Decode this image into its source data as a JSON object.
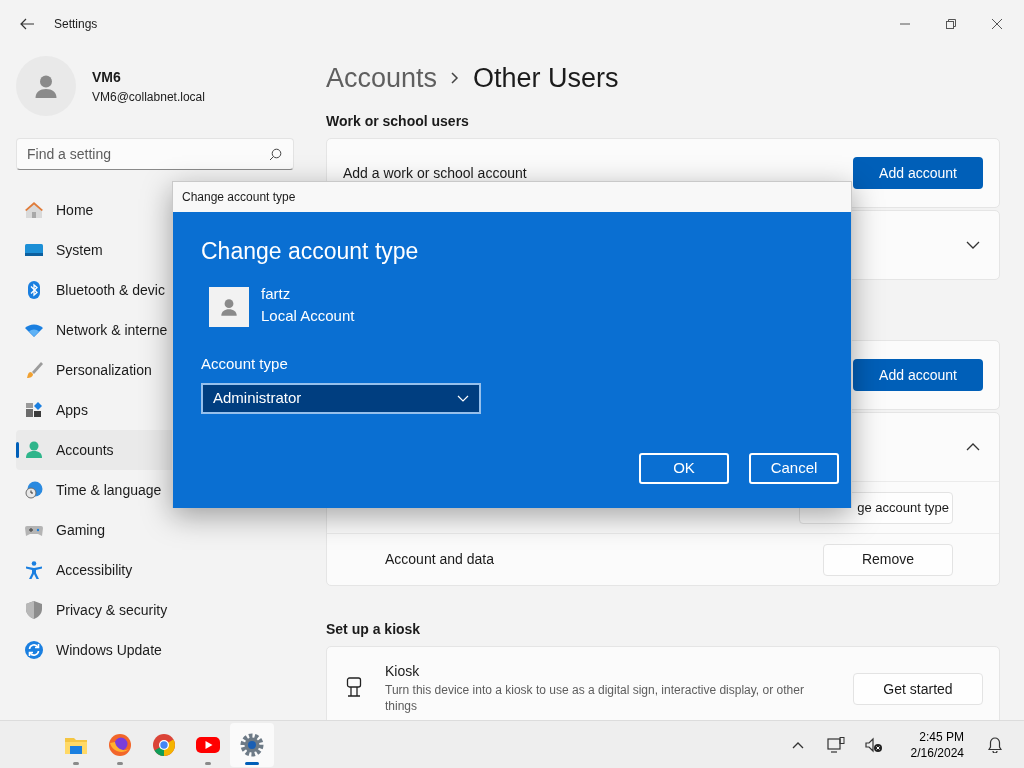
{
  "window": {
    "title": "Settings"
  },
  "user": {
    "name": "VM6",
    "email": "VM6@collabnet.local"
  },
  "search": {
    "placeholder": "Find a setting"
  },
  "nav": [
    {
      "label": "Home",
      "kind": "home",
      "selected": false
    },
    {
      "label": "System",
      "kind": "system",
      "selected": false
    },
    {
      "label": "Bluetooth & devic",
      "kind": "bluetooth",
      "selected": false
    },
    {
      "label": "Network & interne",
      "kind": "network",
      "selected": false
    },
    {
      "label": "Personalization",
      "kind": "brush",
      "selected": false
    },
    {
      "label": "Apps",
      "kind": "apps",
      "selected": false
    },
    {
      "label": "Accounts",
      "kind": "accounts",
      "selected": true
    },
    {
      "label": "Time & language",
      "kind": "time",
      "selected": false
    },
    {
      "label": "Gaming",
      "kind": "gaming",
      "selected": false
    },
    {
      "label": "Accessibility",
      "kind": "accessibility",
      "selected": false
    },
    {
      "label": "Privacy & security",
      "kind": "privacy",
      "selected": false
    },
    {
      "label": "Windows Update",
      "kind": "update",
      "selected": false
    }
  ],
  "breadcrumb": {
    "parent": "Accounts",
    "current": "Other Users"
  },
  "groups": [
    {
      "heading": "Work or school users",
      "cards": [
        {
          "kind": "action",
          "label": "Add a work or school account",
          "button": "Add account"
        },
        {
          "kind": "expander",
          "expanded": false
        }
      ]
    },
    {
      "cards": [
        {
          "kind": "action",
          "button": "Add account"
        },
        {
          "kind": "expander",
          "expanded": true,
          "rows": [
            {
              "button": "ge account type"
            },
            {
              "label": "Account and data",
              "button": "Remove"
            }
          ]
        }
      ]
    },
    {
      "heading": "Set up a kiosk",
      "cards": [
        {
          "kind": "feature",
          "title": "Kiosk",
          "description": "Turn this device into a kiosk to use as a digital sign, interactive display, or other things",
          "button": "Get started"
        }
      ]
    }
  ],
  "dialog": {
    "title_bar": "Change account type",
    "heading": "Change account type",
    "user_name": "fartz",
    "user_type": "Local Account",
    "field_label": "Account type",
    "value": "Administrator",
    "buttons": [
      "OK",
      "Cancel"
    ]
  },
  "taskbar": {
    "apps": [
      {
        "kind": "explorer",
        "running": true,
        "selected": false
      },
      {
        "kind": "firefox",
        "running": true,
        "selected": false
      },
      {
        "kind": "chrome",
        "running": false,
        "selected": false
      },
      {
        "kind": "youtube",
        "running": true,
        "selected": false
      },
      {
        "kind": "settings",
        "running": true,
        "selected": true
      }
    ],
    "time": "2:45 PM",
    "date": "2/16/2024"
  }
}
